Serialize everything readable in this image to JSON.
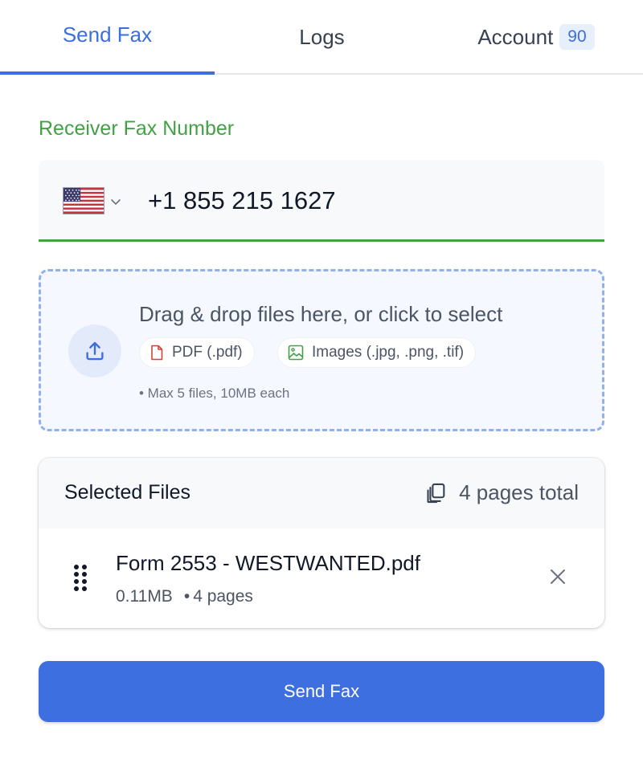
{
  "tabs": {
    "send_fax": "Send Fax",
    "logs": "Logs",
    "account": "Account",
    "account_badge": "90"
  },
  "receiver": {
    "label": "Receiver Fax Number",
    "country_flag": "us-flag-icon",
    "number": "+1 855 215 1627"
  },
  "dropzone": {
    "title": "Drag & drop files here, or click to select",
    "chip_pdf": "PDF (.pdf)",
    "chip_images": "Images (.jpg, .png, .tif)",
    "limit": "• Max 5 files, 10MB each"
  },
  "files": {
    "title": "Selected Files",
    "pages_total": "4 pages total",
    "items": [
      {
        "name": "Form 2553 - WESTWANTED.pdf",
        "size": "0.11MB",
        "pages": "4 pages"
      }
    ]
  },
  "send_button": "Send Fax",
  "colors": {
    "accent": "#3b6fde",
    "success": "#43a047",
    "button": "#3e6fe0"
  }
}
